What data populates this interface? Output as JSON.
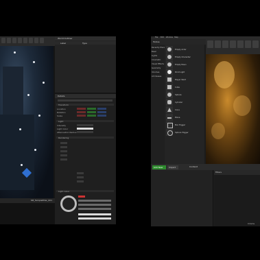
{
  "left_window": {
    "outliner": {
      "title": "World Outliner",
      "col_label": "Label",
      "col_type": "Type"
    },
    "details": {
      "title": "Details",
      "search_placeholder": "Search",
      "sections": [
        "Transform",
        "Light",
        "Rendering"
      ],
      "row_labels": [
        "Location",
        "Rotation",
        "Scale",
        "Intensity",
        "Light Color",
        "Attenuation Radius"
      ],
      "color_section": "Light Color"
    },
    "content_browser": {
      "path_file": "SM_TemplePillar_001"
    }
  },
  "right_window": {
    "menus": [
      "File",
      "Edit",
      "Window",
      "Help"
    ],
    "modes_title": "Modes",
    "categories": [
      "Recently Placed",
      "Basic",
      "Lights",
      "Cinematic",
      "Visual Effects",
      "Geometry",
      "Volumes",
      "All Classes"
    ],
    "place_items": [
      "Empty Actor",
      "Empty Character",
      "Empty Pawn",
      "Point Light",
      "Player Start",
      "Cube",
      "Sphere",
      "Cylinder",
      "Cone",
      "Plane",
      "Box Trigger",
      "Sphere Trigger"
    ],
    "content_browser": {
      "add_new": "Add New",
      "import": "Import",
      "breadcrumb": "Content",
      "filters": "Filters",
      "item_count": "0 items"
    }
  }
}
